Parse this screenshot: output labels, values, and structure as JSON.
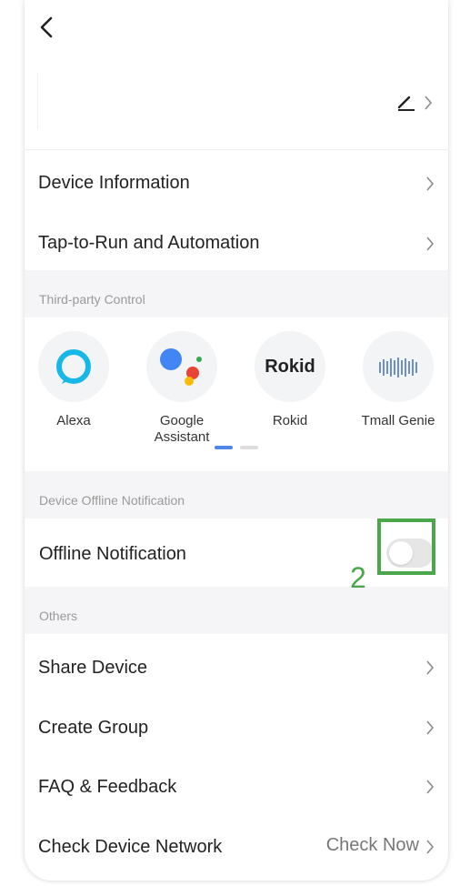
{
  "header": {
    "back_icon": "chevron-left-icon"
  },
  "device": {
    "edit_icon": "pencil-icon"
  },
  "menu": {
    "device_information": "Device Information",
    "tap_to_run": "Tap-to-Run and Automation"
  },
  "third_party": {
    "section_title": "Third-party Control",
    "items": [
      {
        "label": "Alexa",
        "icon": "alexa-icon"
      },
      {
        "label": "Google\nAssistant",
        "icon": "google-assistant-icon"
      },
      {
        "label": "Rokid",
        "icon": "rokid-icon",
        "logo_text": "Rokid"
      },
      {
        "label": "Tmall Genie",
        "icon": "tmall-genie-icon"
      }
    ]
  },
  "offline": {
    "section_title": "Device Offline Notification",
    "label": "Offline Notification",
    "enabled": false
  },
  "annotation": {
    "number": "2",
    "color": "#4aa84a"
  },
  "others": {
    "section_title": "Others",
    "share_device": "Share Device",
    "create_group": "Create Group",
    "faq_feedback": "FAQ & Feedback",
    "check_network": "Check Device Network",
    "check_now": "Check Now"
  },
  "colors": {
    "section_bg": "#f5f5f7",
    "accent_blue": "#4f86e8",
    "alexa_cyan": "#17b7e8"
  }
}
